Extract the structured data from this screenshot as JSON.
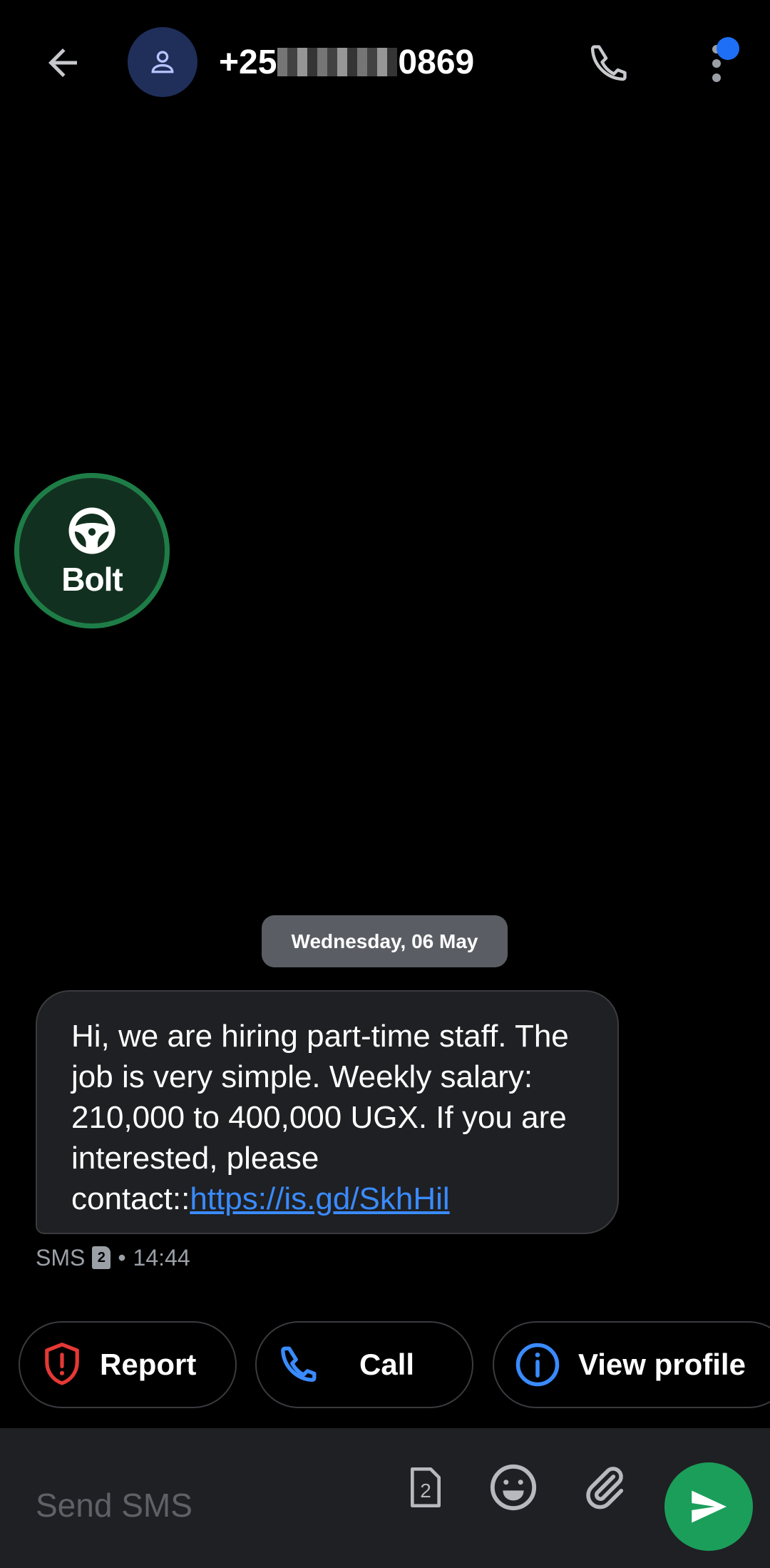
{
  "header": {
    "back_icon": "arrow-left-icon",
    "avatar_icon": "person-icon",
    "title_prefix": "+25",
    "title_suffix": "0869",
    "call_icon": "phone-icon",
    "more_icon": "more-vertical-icon"
  },
  "sender_logo": {
    "text": "Bolt",
    "icon": "steering-wheel-icon"
  },
  "conversation": {
    "date": "Wednesday, 06 May",
    "message": {
      "text": "Hi, we are hiring part-time staff. The job is very simple. Weekly salary: 210,000 to 400,000 UGX. If you are interested, please contact::",
      "link": "https://is.gd/SkhHil",
      "type": "SMS",
      "sim": "2",
      "separator": "•",
      "time": "14:44"
    }
  },
  "actions": {
    "report_label": "Report",
    "call_label": "Call",
    "view_profile_label": "View profile"
  },
  "composer": {
    "placeholder": "Send SMS",
    "sim_label": "2"
  },
  "colors": {
    "accent": "#1e6ff5",
    "send": "#1b9e5a",
    "report": "#e53935",
    "link": "#3a8bff"
  }
}
